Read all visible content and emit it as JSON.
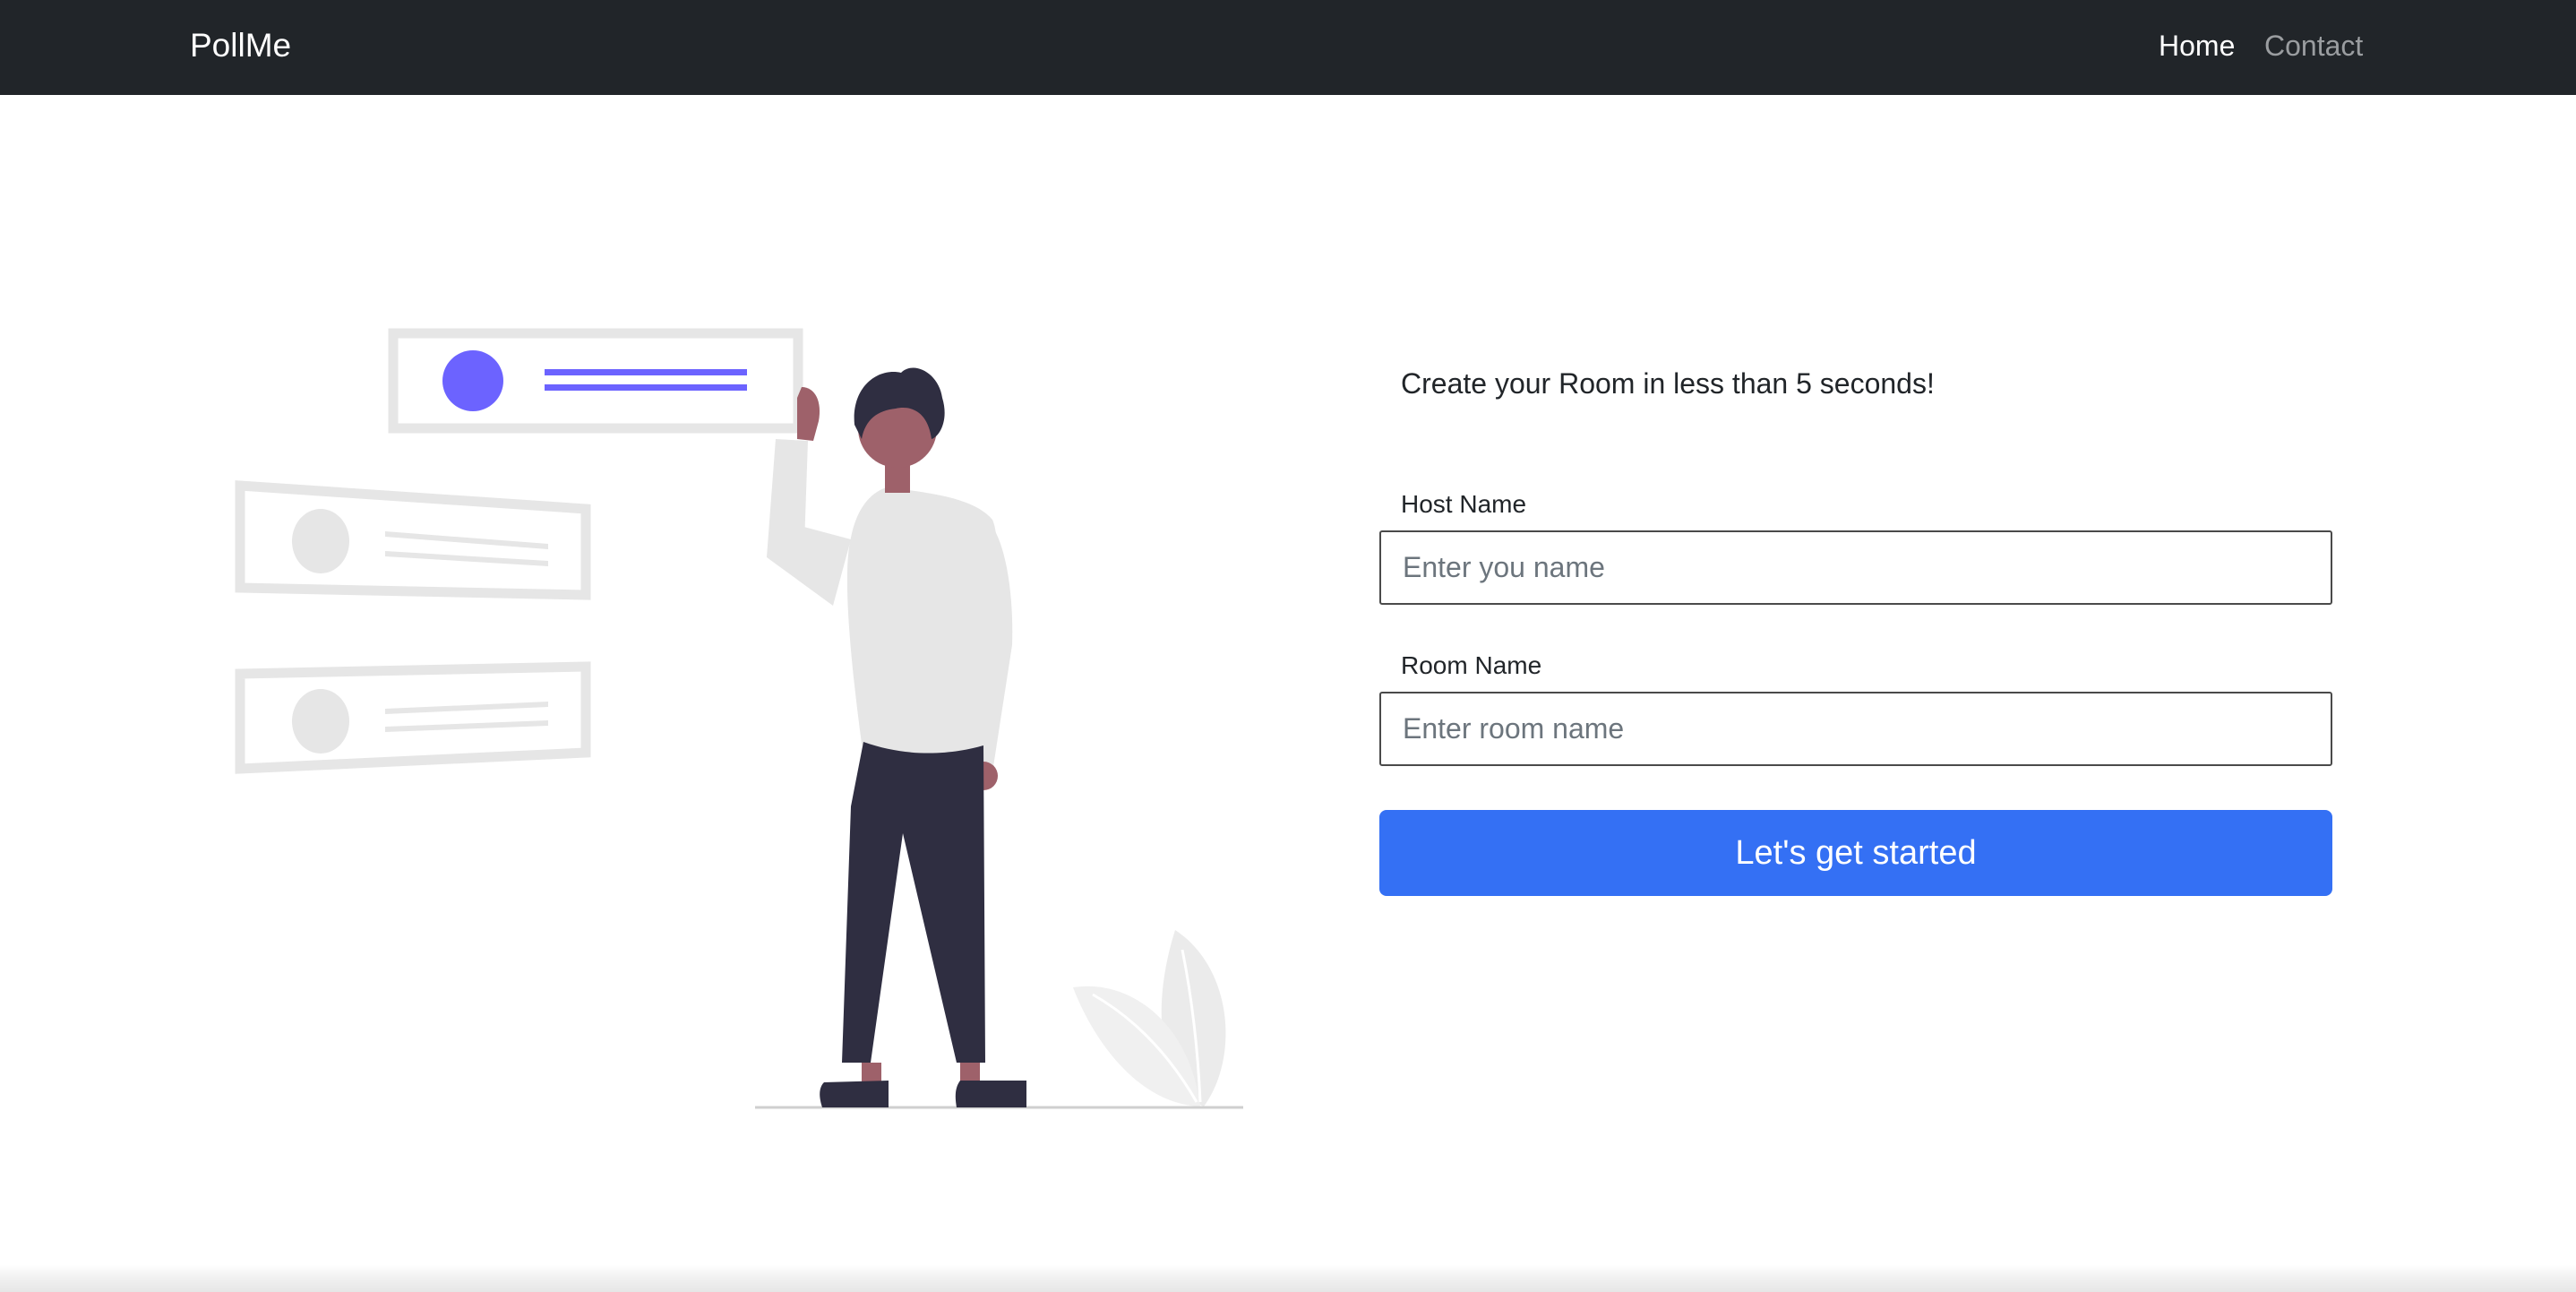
{
  "navbar": {
    "brand": "PollMe",
    "links": [
      {
        "label": "Home",
        "active": true
      },
      {
        "label": "Contact",
        "active": false
      }
    ],
    "background": "#212529"
  },
  "hero": {
    "illustration": "person-presenting-cards-illustration",
    "tagline": "Create your Room in less than 5 seconds!"
  },
  "form": {
    "host": {
      "label": "Host Name",
      "placeholder": "Enter you name",
      "value": ""
    },
    "room": {
      "label": "Room Name",
      "placeholder": "Enter room name",
      "value": ""
    },
    "submit_label": "Let's get started"
  },
  "colors": {
    "accent": "#3470f4",
    "illustration_accent": "#6c63ff",
    "text": "#212529"
  }
}
